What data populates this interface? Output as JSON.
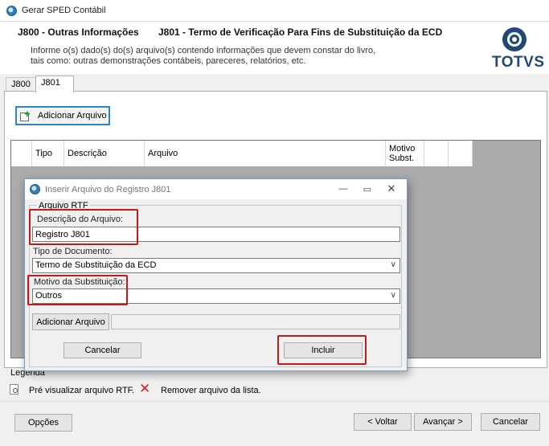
{
  "window": {
    "title": "Gerar SPED Contábil"
  },
  "header": {
    "title_code": "J800 - Outras Informações",
    "title_main": "J801 - Termo de Verificação Para Fins de Substituição da ECD",
    "description_line1": "Informe o(s) dado(s) do(s) arquivo(s) contendo informações que devem constar do livro,",
    "description_line2": "tais como: outras demonstrações contábeis, pareceres, relatórios, etc.",
    "logo_text": "TOTVS"
  },
  "tabs": [
    {
      "label": "J800"
    },
    {
      "label": "J801"
    }
  ],
  "panel": {
    "add_file_label": "Adicionar Arquivo",
    "columns": [
      "Tipo",
      "Descrição",
      "Arquivo",
      "Motivo",
      "Subst."
    ]
  },
  "legend": {
    "title": "Legenda",
    "preview_label": "Pré visualizar arquivo RTF.",
    "remove_label": "Remover arquivo da lista."
  },
  "footer": {
    "options_label": "Opções",
    "back_label": "< Voltar",
    "next_label": "Avançar >",
    "cancel_label": "Cancelar"
  },
  "dialog": {
    "title": "Inserir Arquivo do Registro J801",
    "group_label": "Arquivo RTF",
    "desc_label": "Descrição do Arquivo:",
    "desc_value": "Registro J801",
    "doctype_label": "Tipo de Documento:",
    "doctype_value": "Termo de Substituição da ECD",
    "reason_label": "Motivo da Substituição:",
    "reason_value": "Outros",
    "add_file_label": "Adicionar Arquivo",
    "file_path_value": "",
    "cancel_label": "Cancelar",
    "include_label": "Incluir",
    "highlight_color": "#c01b1b"
  },
  "colors": {
    "focus_border": "#2e86c9",
    "logo_blue": "#1f4a78",
    "grid_background": "#ababab"
  }
}
